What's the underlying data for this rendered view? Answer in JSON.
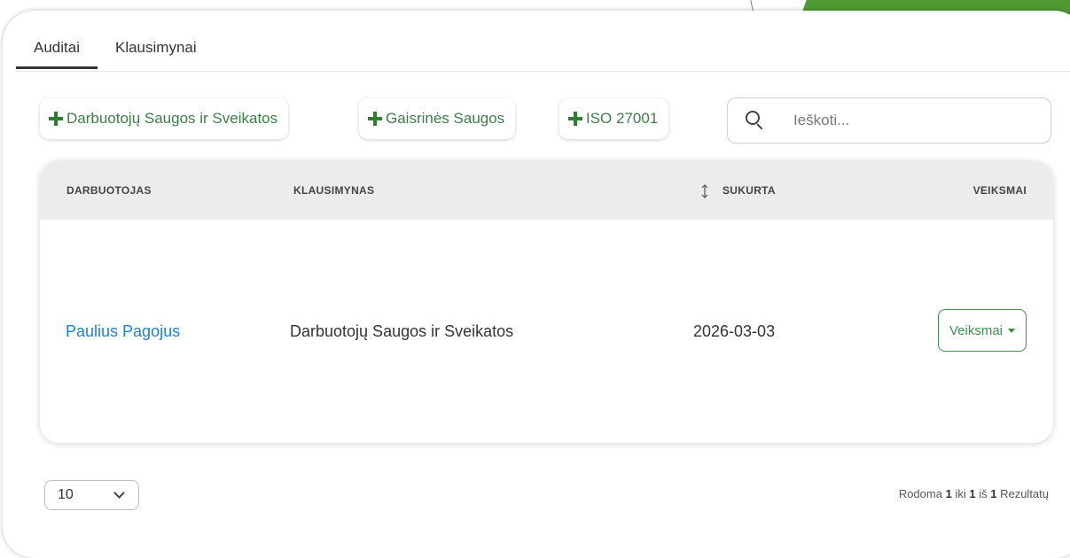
{
  "tabs": [
    {
      "label": "Auditai",
      "active": true
    },
    {
      "label": "Klausimynai",
      "active": false
    }
  ],
  "add_buttons": [
    {
      "label": "Darbuotojų Saugos ir Sveikatos"
    },
    {
      "label": "Gaisrinės Saugos"
    },
    {
      "label": "ISO 27001"
    }
  ],
  "search": {
    "placeholder": "Ieškoti..."
  },
  "table": {
    "columns": [
      "DARBUOTOJAS",
      "KLAUSIMYNAS",
      "SUKURTA",
      "VEIKSMAI"
    ],
    "rows": [
      {
        "employee": "Paulius Pagojus",
        "questionnaire": "Darbuotojų Saugos ir Sveikatos",
        "created": "2026-03-03",
        "actions_label": "Veiksmai"
      }
    ]
  },
  "pagination": {
    "page_size": "10",
    "results_prefix": "Rodoma",
    "from": "1",
    "to_word": "iki",
    "to": "1",
    "of_word": "iš",
    "total": "1",
    "results_suffix": "Rezultatų"
  },
  "colors": {
    "accent": "#3d8f4c",
    "link": "#1e7fd6",
    "brand_green": "#4f9a32"
  }
}
